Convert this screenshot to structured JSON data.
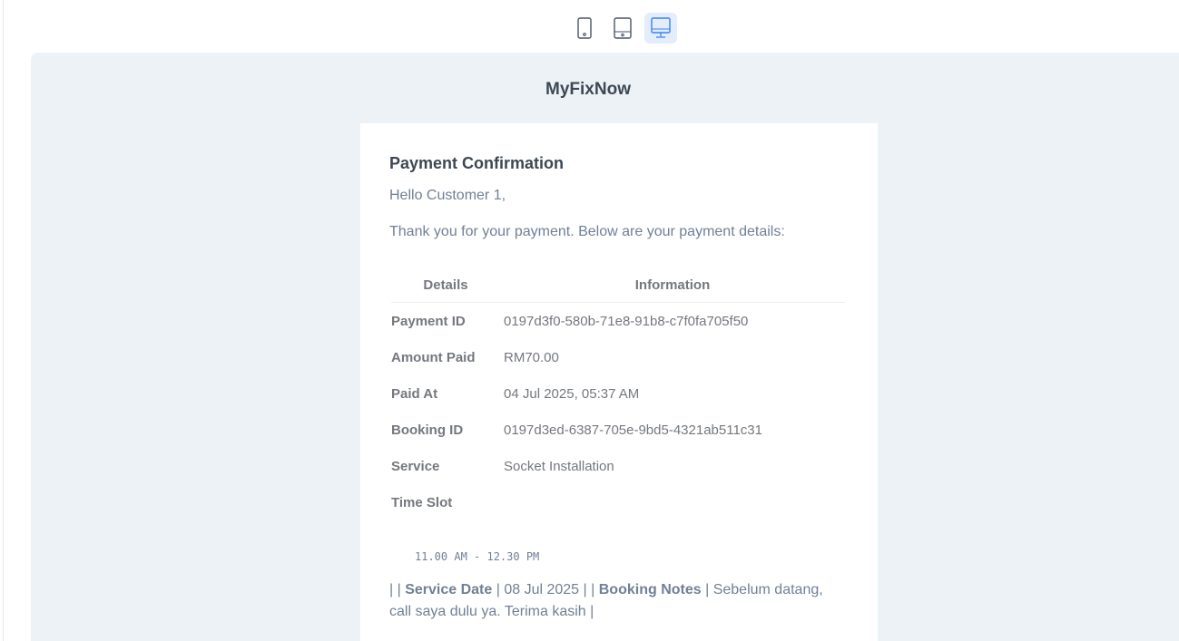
{
  "toolbar": {
    "devices": [
      {
        "name": "mobile",
        "icon": "phone-icon",
        "active": false
      },
      {
        "name": "tablet",
        "icon": "tablet-icon",
        "active": false
      },
      {
        "name": "desktop",
        "icon": "desktop-icon",
        "active": true
      }
    ],
    "active_color": "#3b82f6"
  },
  "email": {
    "brand": "MyFixNow",
    "title": "Payment Confirmation",
    "greeting": "Hello Customer 1,",
    "intro": "Thank you for your payment. Below are your payment details:",
    "table": {
      "headers": [
        "Details",
        "Information"
      ],
      "rows": [
        {
          "label": "Payment ID",
          "value": "0197d3f0-580b-71e8-91b8-c7f0fa705f50"
        },
        {
          "label": "Amount Paid",
          "value": "RM70.00"
        },
        {
          "label": "Paid At",
          "value": "04 Jul 2025, 05:37 AM"
        },
        {
          "label": "Booking ID",
          "value": "0197d3ed-6387-705e-9bd5-4321ab511c31"
        },
        {
          "label": "Service",
          "value": "Socket Installation"
        },
        {
          "label": "Time Slot",
          "value": ""
        }
      ]
    },
    "time_slot_code": "11.00 AM - 12.30 PM",
    "trailing": {
      "sep1": "| |",
      "service_date_label": "Service Date",
      "sep2": "|",
      "service_date_value": "08 Jul 2025",
      "sep3": "| |",
      "booking_notes_label": "Booking Notes",
      "sep4": "|",
      "booking_notes_value": "Sebelum datang, call saya dulu ya. Terima kasih",
      "sep5": "|"
    }
  },
  "colors": {
    "preview_bg": "#edf2f7",
    "card_bg": "#ffffff",
    "heading": "#3d4852",
    "text": "#718096"
  }
}
